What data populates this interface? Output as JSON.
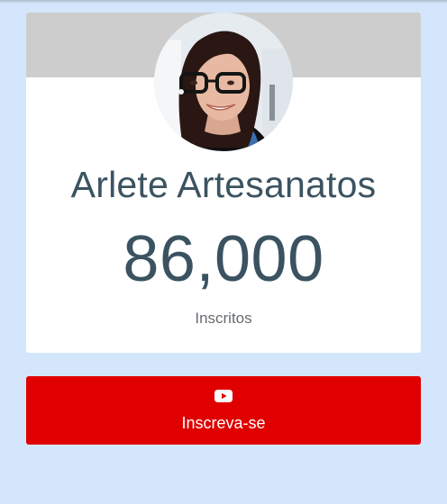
{
  "channel": {
    "name": "Arlete Artesanatos",
    "subscriber_count": "86,000",
    "subscriber_label": "Inscritos"
  },
  "subscribe_button": {
    "label": "Inscreva-se",
    "icon": "youtube-icon"
  },
  "colors": {
    "page_background": "#d4e6fb",
    "banner": "#cdcdcd",
    "accent_red": "#e00000",
    "text_primary": "#3b5361",
    "text_secondary": "#666b70"
  }
}
